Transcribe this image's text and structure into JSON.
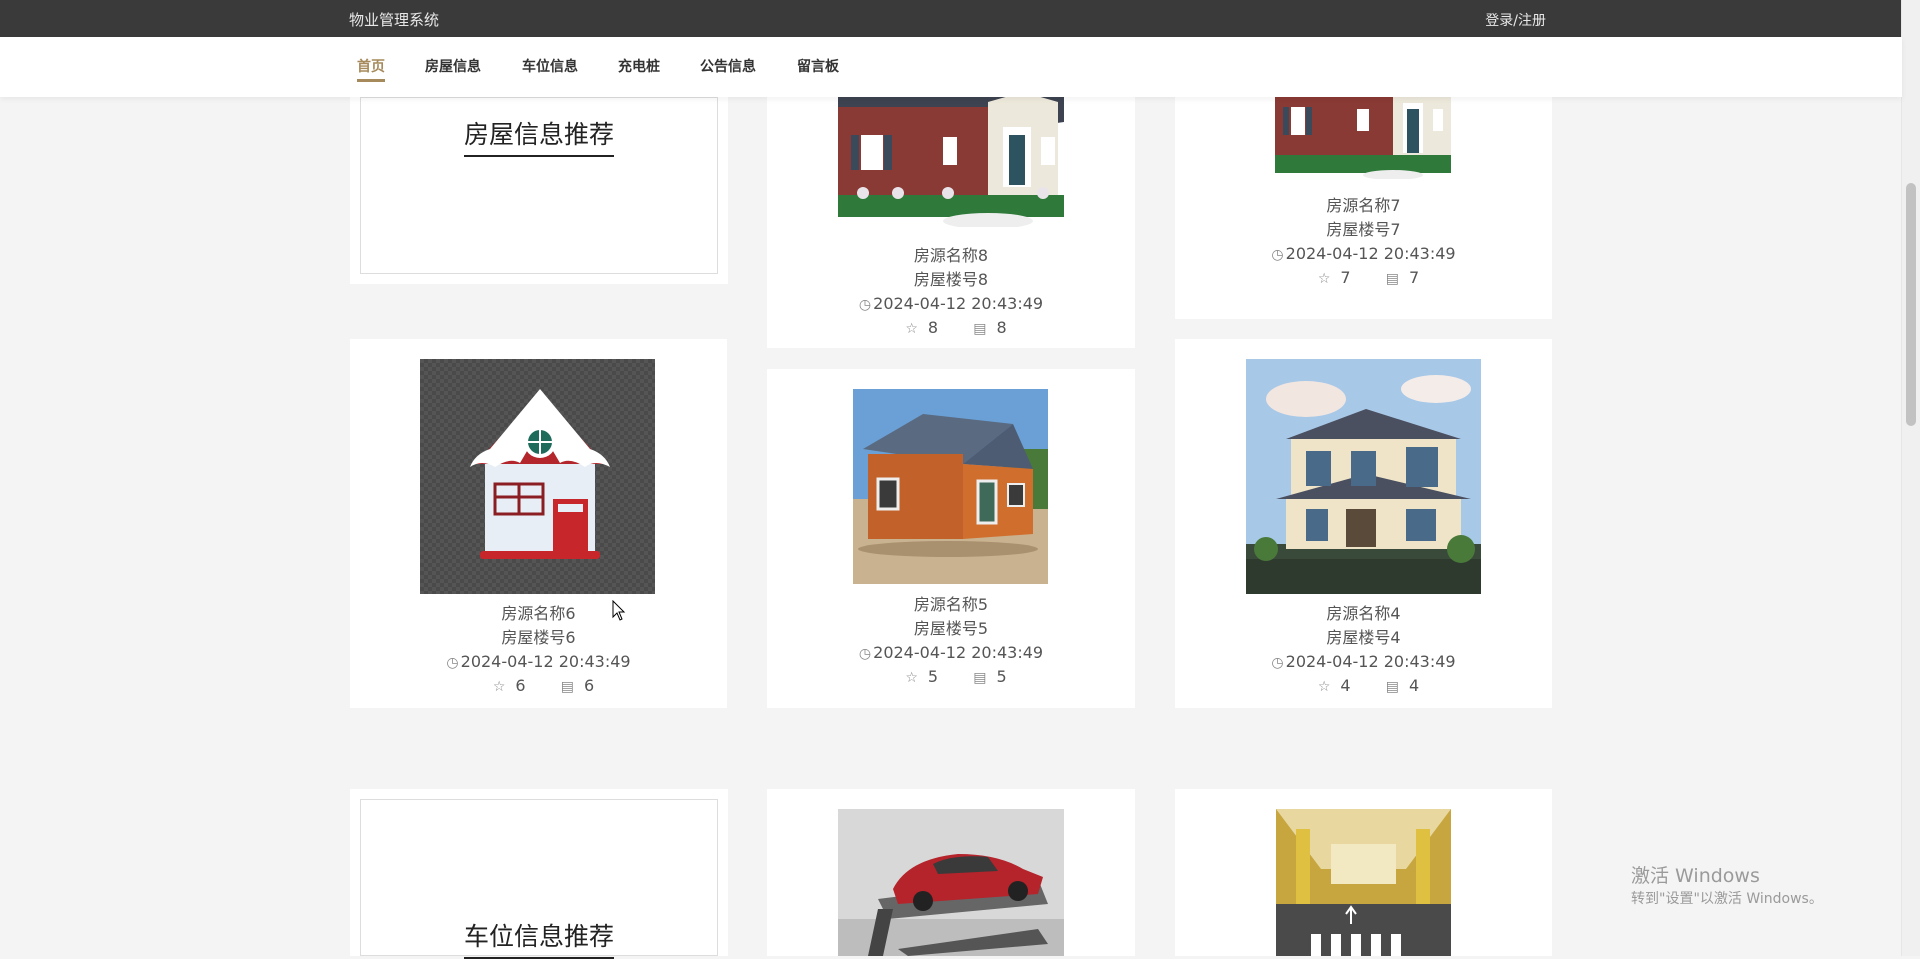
{
  "app": {
    "title": "物业管理系统",
    "login_label": "登录/注册"
  },
  "nav": {
    "items": [
      {
        "label": "首页",
        "active": true
      },
      {
        "label": "房屋信息",
        "active": false
      },
      {
        "label": "车位信息",
        "active": false
      },
      {
        "label": "充电桩",
        "active": false
      },
      {
        "label": "公告信息",
        "active": false
      },
      {
        "label": "留言板",
        "active": false
      }
    ]
  },
  "house_section": {
    "title": "房屋信息推荐",
    "items": [
      {
        "name": "房源名称8",
        "building": "房屋楼号8",
        "time": "2024-04-12 20:43:49",
        "likes": "8",
        "comments": "8"
      },
      {
        "name": "房源名称7",
        "building": "房屋楼号7",
        "time": "2024-04-12 20:43:49",
        "likes": "7",
        "comments": "7"
      },
      {
        "name": "房源名称6",
        "building": "房屋楼号6",
        "time": "2024-04-12 20:43:49",
        "likes": "6",
        "comments": "6"
      },
      {
        "name": "房源名称5",
        "building": "房屋楼号5",
        "time": "2024-04-12 20:43:49",
        "likes": "5",
        "comments": "5"
      },
      {
        "name": "房源名称4",
        "building": "房屋楼号4",
        "time": "2024-04-12 20:43:49",
        "likes": "4",
        "comments": "4"
      }
    ]
  },
  "parking_section": {
    "title": "车位信息推荐"
  },
  "watermark": {
    "line1": "激活 Windows",
    "line2": "转到\"设置\"以激活 Windows。"
  },
  "colors": {
    "accent": "#a68a5b",
    "topbar": "#3a3a3a",
    "background": "#f4f4f4"
  },
  "icons": {
    "clock": "clock-icon",
    "star": "star-icon",
    "comment": "comment-icon"
  }
}
